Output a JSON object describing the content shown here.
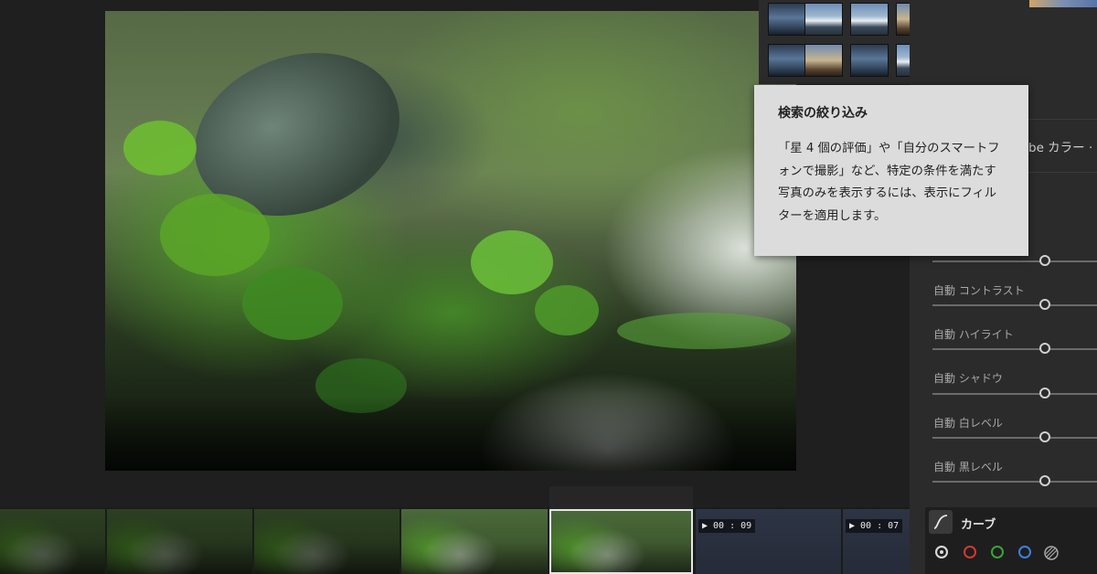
{
  "tooltip": {
    "title": "検索の絞り込み",
    "body": "「星 4 個の評価」や「自分のスマートフォンで撮影」など、特定の条件を満たす写真のみを表示するには、表示にフィルターを適用します。"
  },
  "profile": {
    "label": "be カラー ·"
  },
  "sliders": [
    {
      "label": "",
      "value": 0
    },
    {
      "label": "自動 コントラスト",
      "value": 0
    },
    {
      "label": "自動 ハイライト",
      "value": 0
    },
    {
      "label": "自動 シャドウ",
      "value": 0
    },
    {
      "label": "自動 白レベル",
      "value": 0
    },
    {
      "label": "自動 黒レベル",
      "value": 0
    }
  ],
  "curve": {
    "label": "カーブ",
    "channels": [
      "all",
      "red",
      "green",
      "blue",
      "custom"
    ],
    "colors": {
      "all": "#d9d9d9",
      "red": "#d8372f",
      "green": "#3ca23a",
      "blue": "#3f7fe0"
    }
  },
  "filmstrip": {
    "videos": [
      {
        "duration": "▶ 00 : 09"
      },
      {
        "duration": "▶ 00 : 07"
      }
    ]
  }
}
